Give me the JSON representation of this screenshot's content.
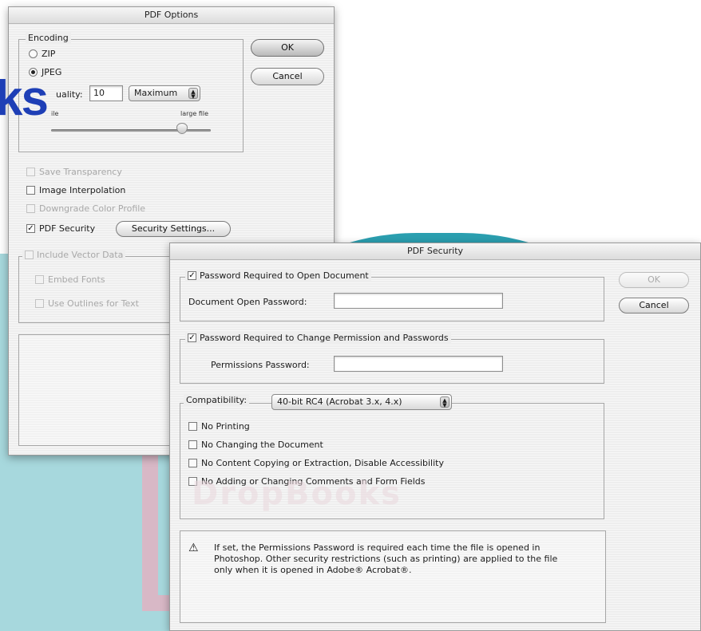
{
  "pdf_options": {
    "title": "PDF Options",
    "encoding_label": "Encoding",
    "zip_label": "ZIP",
    "jpeg_label": "JPEG",
    "quality_label": "uality:",
    "quality_value": "10",
    "quality_preset": "Maximum",
    "small_file_label": "ile",
    "large_file_label": "large file",
    "ok_label": "OK",
    "cancel_label": "Cancel",
    "save_transparency_label": "Save Transparency",
    "image_interpolation_label": "Image Interpolation",
    "downgrade_color_label": "Downgrade Color Profile",
    "pdf_security_label": "PDF Security",
    "security_settings_label": "Security Settings...",
    "include_vector_label": "Include Vector Data",
    "embed_fonts_label": "Embed Fonts",
    "use_outlines_label": "Use Outlines for Text"
  },
  "pdf_security": {
    "title": "PDF Security",
    "password_open_label": "Password Required to Open Document",
    "doc_open_password_label": "Document Open Password:",
    "doc_open_password_value": "",
    "password_change_label": "Password Required to Change Permission and Passwords",
    "permissions_password_label": "Permissions Password:",
    "permissions_password_value": "",
    "compatibility_label": "Compatibility:",
    "compatibility_value": "40-bit RC4 (Acrobat 3.x, 4.x)",
    "no_printing_label": "No Printing",
    "no_changing_label": "No Changing the Document",
    "no_copying_label": "No Content Copying or Extraction, Disable Accessibility",
    "no_comments_label": "No Adding or Changing Comments and Form Fields",
    "ok_label": "OK",
    "cancel_label": "Cancel",
    "info_text": "If set, the Permissions Password is required each time the file is opened in Photoshop. Other security restrictions (such as printing) are applied to the file only when it is opened in Adobe® Acrobat®."
  },
  "watermark": {
    "ks_text": "ks"
  },
  "colors": {
    "watermark_teal_light": "#a7d8dd",
    "watermark_teal": "#2b9fb0",
    "watermark_blue": "#1e3fb6",
    "watermark_pink": "#d8b8c6"
  }
}
